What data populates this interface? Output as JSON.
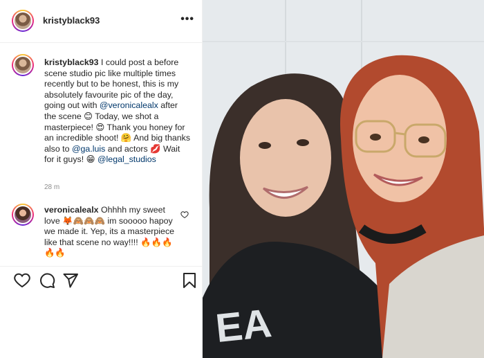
{
  "header": {
    "username": "kristyblack93",
    "more_icon": "more-horizontal-icon"
  },
  "caption": {
    "username": "kristyblack93",
    "parts": [
      {
        "t": "I could post a before scene studio pic like multiple times recently but to be honest, this is my absolutely favourite pic of the day, going out with "
      },
      {
        "t": "@veronicalealx",
        "mention": true
      },
      {
        "t": " after the scene 😊 Today, we shot a masterpiece! 😍 Thank you honey for an incredible shoot! 🤗 And big thanks also to "
      },
      {
        "t": "@ga.luis",
        "mention": true
      },
      {
        "t": " and actors 💋 Wait for it guys! 😁 "
      },
      {
        "t": "@legal_studios",
        "mention": true
      }
    ],
    "time": "28 m"
  },
  "reply": {
    "username": "veronicalealx",
    "text": "Ohhhh my sweet love 🦊🙈🙈🙈 im sooooo hapoy we made it. Yep, its a masterpiece like that scene no way!!!! 🔥🔥🔥🔥🔥"
  },
  "actions": {
    "like_icon": "heart-icon",
    "comment_icon": "comment-icon",
    "share_icon": "send-icon",
    "save_icon": "bookmark-icon"
  },
  "photo": {
    "description_icon": "selfie-photo"
  }
}
